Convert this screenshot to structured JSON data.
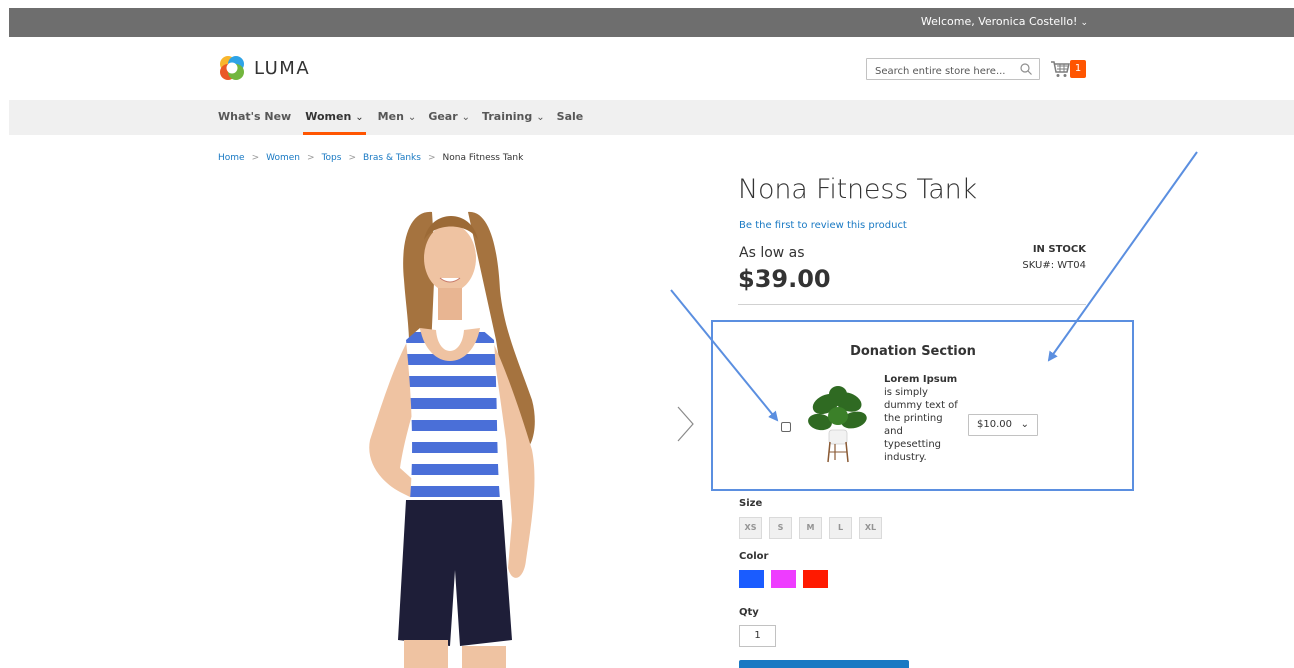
{
  "header": {
    "welcome_text": "Welcome, Veronica Costello!",
    "logo_text": "LUMA",
    "search_placeholder": "Search entire store here...",
    "cart_count": "1"
  },
  "nav": {
    "items": [
      {
        "label": "What's New",
        "has_dropdown": false
      },
      {
        "label": "Women",
        "has_dropdown": true,
        "active": true
      },
      {
        "label": "Men",
        "has_dropdown": true
      },
      {
        "label": "Gear",
        "has_dropdown": true
      },
      {
        "label": "Training",
        "has_dropdown": true
      },
      {
        "label": "Sale",
        "has_dropdown": false
      }
    ]
  },
  "breadcrumb": {
    "items": [
      "Home",
      "Women",
      "Tops",
      "Bras & Tanks"
    ],
    "current": "Nona Fitness Tank"
  },
  "product": {
    "title": "Nona Fitness Tank",
    "review_link": "Be the first to review this product",
    "price_prefix": "As low as",
    "price": "$39.00",
    "stock": "IN STOCK",
    "sku": "SKU#:  WT04"
  },
  "donation": {
    "title": "Donation Section",
    "text_bold": "Lorem Ipsum",
    "text_rest": " is simply dummy text of the printing and typesetting industry.",
    "amount": "$10.00"
  },
  "options": {
    "size_label": "Size",
    "sizes": [
      "XS",
      "S",
      "M",
      "L",
      "XL"
    ],
    "color_label": "Color",
    "colors": [
      "#1a5cff",
      "#ee3cff",
      "#ff1a00"
    ],
    "qty_label": "Qty",
    "qty_value": "1"
  },
  "colors": {
    "accent": "#ff5501",
    "link": "#1979c3",
    "annotation": "#5b8fe0"
  }
}
